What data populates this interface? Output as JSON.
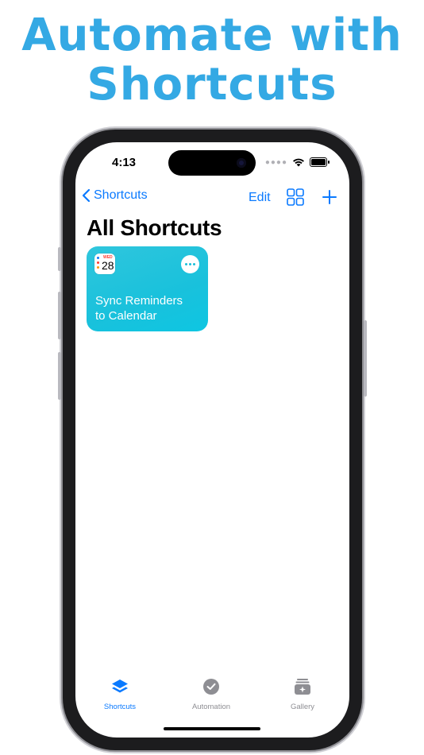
{
  "promo": {
    "headline_line1": "Automate with",
    "headline_line2": "Shortcuts",
    "headline_color": "#34a9e4"
  },
  "status_bar": {
    "time": "4:13"
  },
  "nav": {
    "back_label": "Shortcuts",
    "edit_label": "Edit"
  },
  "page": {
    "title": "All Shortcuts"
  },
  "shortcut_card": {
    "calendar_weekday": "WED",
    "calendar_day": "28",
    "title_line1": "Sync Reminders",
    "title_line2": "to Calendar",
    "color": "#19c1dc"
  },
  "tabbar": {
    "tabs": [
      {
        "label": "Shortcuts",
        "icon": "layers-icon",
        "active": true
      },
      {
        "label": "Automation",
        "icon": "clock-check-icon",
        "active": false
      },
      {
        "label": "Gallery",
        "icon": "gallery-icon",
        "active": false
      }
    ]
  },
  "colors": {
    "accent": "#0a7aff",
    "tab_inactive": "#8e8e93"
  }
}
